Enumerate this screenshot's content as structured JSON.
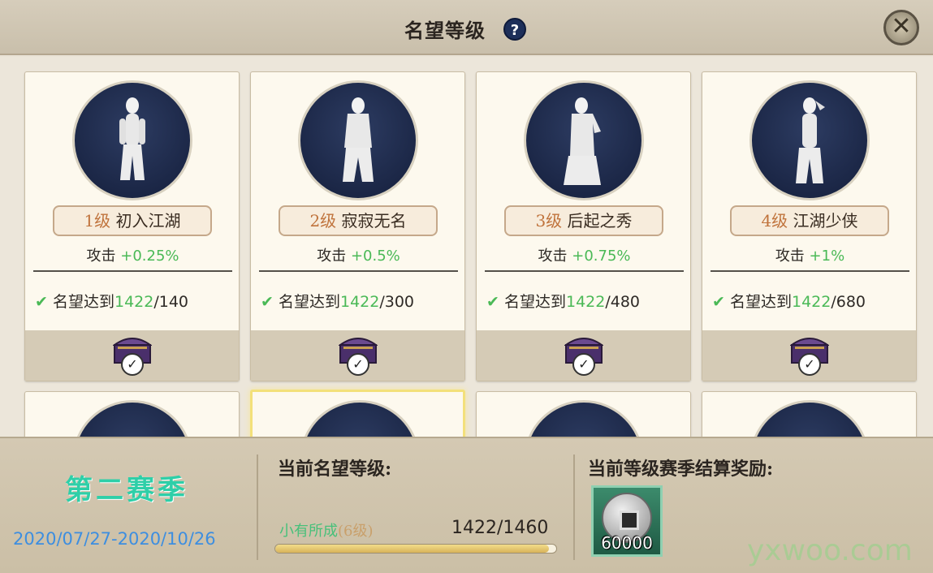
{
  "header": {
    "title": "名望等级",
    "help_icon": "?",
    "close_icon": "close-icon"
  },
  "cards": [
    {
      "level": "1级",
      "name": "初入江湖",
      "attack_label": "攻击",
      "attack_value": "+0.25%",
      "req_label": "名望达到",
      "req_current": "1422",
      "req_target": "/140"
    },
    {
      "level": "2级",
      "name": "寂寂无名",
      "attack_label": "攻击",
      "attack_value": "+0.5%",
      "req_label": "名望达到",
      "req_current": "1422",
      "req_target": "/300"
    },
    {
      "level": "3级",
      "name": "后起之秀",
      "attack_label": "攻击",
      "attack_value": "+0.75%",
      "req_label": "名望达到",
      "req_current": "1422",
      "req_target": "/480"
    },
    {
      "level": "4级",
      "name": "江湖少侠",
      "attack_label": "攻击",
      "attack_value": "+1%",
      "req_label": "名望达到",
      "req_current": "1422",
      "req_target": "/680"
    }
  ],
  "bottom": {
    "season_name": "第二赛季",
    "season_dates": "2020/07/27-2020/10/26",
    "current_label": "当前名望等级:",
    "current_level_name": "小有所成",
    "current_level_num": "(6级)",
    "progress_text": "1422/1460",
    "progress_fraction": 0.974,
    "reward_label": "当前等级赛季结算奖励:",
    "reward_count": "60000"
  },
  "watermark": "yxwoo.com"
}
